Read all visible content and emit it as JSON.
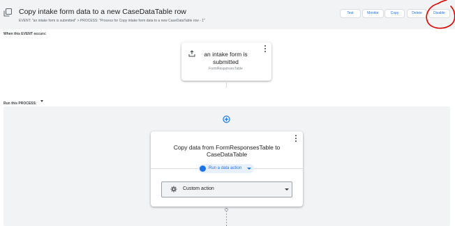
{
  "header": {
    "title": "Copy intake form data to a new CaseDataTable row",
    "subtitle": "EVENT: \"an intake form is submitted\" > PROCESS: \"Process for Copy intake form data to a new CaseDataTable row - 1\"",
    "buttons": {
      "test": "Test",
      "monitor": "Monitor",
      "copy": "Copy",
      "delete": "Delete",
      "disable": "Disable"
    },
    "icons": {
      "bot": "copy-icon"
    }
  },
  "event_section": {
    "label": "When this EVENT occurs:",
    "card": {
      "title": "an intake form is submitted",
      "subtitle": "FormResponsesTable",
      "icon": "form-upload-icon"
    }
  },
  "process_section": {
    "label": "Run this PROCESS:",
    "add_icon": "add-circle-icon",
    "step_card": {
      "title": "Copy data from FormResponsesTable to CaseDataTable",
      "action_chip": "Run a data action",
      "action_type": "Custom action",
      "action_icon": "gear-icon"
    }
  },
  "colors": {
    "header_bg": "#f1f3f4",
    "accent": "#1a73e8",
    "annotation": "#e00000",
    "panel_bg": "#f1f3f4"
  }
}
